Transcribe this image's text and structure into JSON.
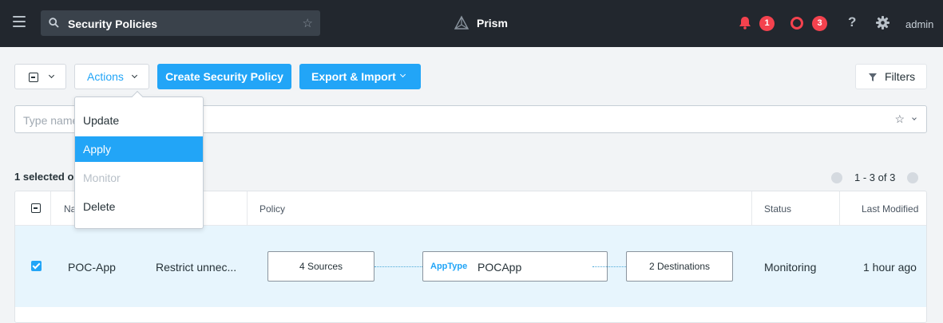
{
  "header": {
    "search_value": "Security Policies",
    "brand": "Prism",
    "alerts_count": "1",
    "events_count": "3",
    "user": "admin"
  },
  "toolbar": {
    "actions_label": "Actions",
    "create_label": "Create Security Policy",
    "export_label": "Export & Import",
    "filters_label": "Filters"
  },
  "filter_input": {
    "placeholder": "Type name"
  },
  "summary": {
    "selected_text": "1 selected o",
    "pagination": "1 - 3 of 3"
  },
  "actions_menu": {
    "items": [
      {
        "label": "Update",
        "state": "normal"
      },
      {
        "label": "Apply",
        "state": "active"
      },
      {
        "label": "Monitor",
        "state": "disabled"
      },
      {
        "label": "Delete",
        "state": "normal"
      }
    ]
  },
  "table": {
    "columns": {
      "name": "Na",
      "policy": "Policy",
      "status": "Status",
      "last_modified": "Last Modified"
    },
    "rows": [
      {
        "selected": true,
        "name": "POC-App",
        "purpose": "Restrict unnec...",
        "sources": "4 Sources",
        "apptype_key": "AppType",
        "apptype_value": "POCApp",
        "destinations": "2 Destinations",
        "status": "Monitoring",
        "last_modified": "1 hour ago"
      }
    ]
  },
  "colors": {
    "accent": "#22a5f7",
    "topbar": "#22272e",
    "alert": "#f4424e",
    "selected_row": "#e7f5fd"
  }
}
